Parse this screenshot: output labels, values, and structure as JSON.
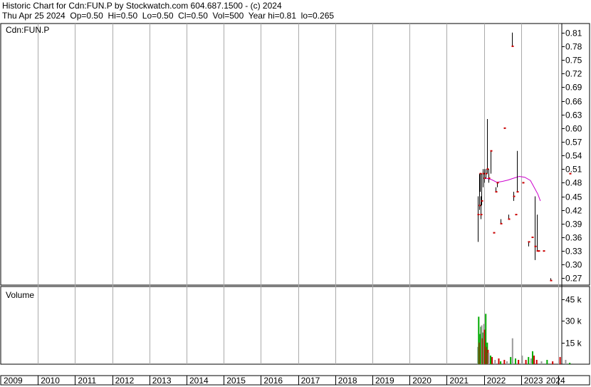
{
  "header": {
    "title": "Historic Chart for Cdn:FUN.P by Stockwatch.com 604.687.1500 - (c) 2024",
    "quote": "Thu Apr 25 2024  Op=0.50  Hi=0.50  Lo=0.50  Cl=0.50  Vol=500  Year hi=0.81  lo=0.265"
  },
  "colors": {
    "frame": "#000000",
    "grid": "#aaaaaa",
    "price_bar": "#000000",
    "close_mark": "#cc0000",
    "moving_average": "#cc00cc",
    "volume_up": "#00aa00",
    "volume_down": "#cc0000",
    "volume_flat": "#999999"
  },
  "chart_data": [
    {
      "type": "line",
      "title": "Cdn:FUN.P",
      "ylim": [
        0.255,
        0.83
      ],
      "y_ticks": [
        "0.81",
        "0.78",
        "0.75",
        "0.72",
        "0.69",
        "0.66",
        "0.63",
        "0.60",
        "0.57",
        "0.54",
        "0.51",
        "0.48",
        "0.45",
        "0.42",
        "0.39",
        "0.36",
        "0.33",
        "0.30",
        "0.27"
      ],
      "grid": true,
      "x_range": [
        2009.0,
        2024.33
      ],
      "series": [
        {
          "kind": "hlc_bars",
          "points": [
            {
              "x": 2021.84,
              "hi": 0.45,
              "lo": 0.35,
              "c": 0.41
            },
            {
              "x": 2021.87,
              "hi": 0.5,
              "lo": 0.42,
              "c": 0.43
            },
            {
              "x": 2021.9,
              "hi": 0.5,
              "lo": 0.46,
              "c": 0.5
            },
            {
              "x": 2021.92,
              "hi": 0.45,
              "lo": 0.4,
              "c": 0.41
            },
            {
              "x": 2021.94,
              "hi": 0.5,
              "lo": 0.43,
              "c": 0.44
            },
            {
              "x": 2021.97,
              "hi": 0.51,
              "lo": 0.47,
              "c": 0.5
            },
            {
              "x": 2022.0,
              "hi": 0.51,
              "lo": 0.48,
              "c": 0.49
            },
            {
              "x": 2022.05,
              "hi": 0.51,
              "lo": 0.49,
              "c": 0.5
            },
            {
              "x": 2022.09,
              "hi": 0.62,
              "lo": 0.5,
              "c": 0.51
            },
            {
              "x": 2022.13,
              "hi": 0.51,
              "lo": 0.48,
              "c": 0.49
            },
            {
              "x": 2022.18,
              "hi": 0.55,
              "lo": 0.5,
              "c": 0.55
            },
            {
              "x": 2022.25,
              "hi": 0.37,
              "lo": 0.37,
              "c": 0.37
            },
            {
              "x": 2022.32,
              "hi": 0.47,
              "lo": 0.46,
              "c": 0.46
            },
            {
              "x": 2022.35,
              "hi": 0.48,
              "lo": 0.47,
              "c": 0.48
            },
            {
              "x": 2022.45,
              "hi": 0.4,
              "lo": 0.39,
              "c": 0.39
            },
            {
              "x": 2022.55,
              "hi": 0.6,
              "lo": 0.6,
              "c": 0.6
            },
            {
              "x": 2022.65,
              "hi": 0.41,
              "lo": 0.4,
              "c": 0.4
            },
            {
              "x": 2022.75,
              "hi": 0.81,
              "lo": 0.78,
              "c": 0.78
            },
            {
              "x": 2022.79,
              "hi": 0.46,
              "lo": 0.44,
              "c": 0.45
            },
            {
              "x": 2022.85,
              "hi": 0.41,
              "lo": 0.41,
              "c": 0.41
            },
            {
              "x": 2022.88,
              "hi": 0.55,
              "lo": 0.46,
              "c": 0.46
            },
            {
              "x": 2023.05,
              "hi": 0.48,
              "lo": 0.48,
              "c": 0.48
            },
            {
              "x": 2023.2,
              "hi": 0.35,
              "lo": 0.34,
              "c": 0.35
            },
            {
              "x": 2023.3,
              "hi": 0.36,
              "lo": 0.36,
              "c": 0.36
            },
            {
              "x": 2023.36,
              "hi": 0.45,
              "lo": 0.31,
              "c": 0.34
            },
            {
              "x": 2023.42,
              "hi": 0.41,
              "lo": 0.33,
              "c": 0.33
            },
            {
              "x": 2023.47,
              "hi": 0.33,
              "lo": 0.33,
              "c": 0.33
            },
            {
              "x": 2023.6,
              "hi": 0.33,
              "lo": 0.33,
              "c": 0.33
            },
            {
              "x": 2023.78,
              "hi": 0.27,
              "lo": 0.265,
              "c": 0.265
            },
            {
              "x": 2024.31,
              "hi": 0.5,
              "lo": 0.5,
              "c": 0.5
            }
          ]
        },
        {
          "kind": "moving_average",
          "points": [
            [
              2022.05,
              0.49
            ],
            [
              2022.2,
              0.487
            ],
            [
              2022.35,
              0.481
            ],
            [
              2022.5,
              0.483
            ],
            [
              2022.65,
              0.486
            ],
            [
              2022.8,
              0.49
            ],
            [
              2022.95,
              0.494
            ],
            [
              2023.1,
              0.492
            ],
            [
              2023.25,
              0.485
            ],
            [
              2023.35,
              0.47
            ],
            [
              2023.45,
              0.455
            ],
            [
              2023.52,
              0.44
            ]
          ]
        }
      ]
    },
    {
      "type": "bar",
      "title": "Volume",
      "ylim": [
        0,
        54000
      ],
      "y_ticks": [
        "45 k",
        "30 k",
        "15 k"
      ],
      "y_tick_values": [
        45000,
        30000,
        15000
      ],
      "x_tick_labels": [
        "2009",
        "2010",
        "2011",
        "2012",
        "2013",
        "2014",
        "2015",
        "2016",
        "2017",
        "2018",
        "2019",
        "2020",
        "2021",
        "2022",
        "2023",
        "2024"
      ],
      "bars": [
        {
          "x": 2021.84,
          "v": 12000,
          "c": "volume_flat"
        },
        {
          "x": 2021.86,
          "v": 33000,
          "c": "volume_up"
        },
        {
          "x": 2021.88,
          "v": 15000,
          "c": "volume_down"
        },
        {
          "x": 2021.9,
          "v": 21000,
          "c": "volume_up"
        },
        {
          "x": 2021.92,
          "v": 26000,
          "c": "volume_up"
        },
        {
          "x": 2021.94,
          "v": 27000,
          "c": "volume_flat"
        },
        {
          "x": 2021.96,
          "v": 18000,
          "c": "volume_down"
        },
        {
          "x": 2021.98,
          "v": 22000,
          "c": "volume_up"
        },
        {
          "x": 2022.0,
          "v": 28000,
          "c": "volume_flat"
        },
        {
          "x": 2022.02,
          "v": 24000,
          "c": "volume_down"
        },
        {
          "x": 2022.05,
          "v": 35000,
          "c": "volume_up"
        },
        {
          "x": 2022.07,
          "v": 12000,
          "c": "volume_down"
        },
        {
          "x": 2022.09,
          "v": 15000,
          "c": "volume_up"
        },
        {
          "x": 2022.11,
          "v": 10000,
          "c": "volume_down"
        },
        {
          "x": 2022.13,
          "v": 8000,
          "c": "volume_flat"
        },
        {
          "x": 2022.18,
          "v": 6000,
          "c": "volume_up"
        },
        {
          "x": 2022.22,
          "v": 5000,
          "c": "volume_down"
        },
        {
          "x": 2022.3,
          "v": 3000,
          "c": "volume_flat"
        },
        {
          "x": 2022.4,
          "v": 4000,
          "c": "volume_down"
        },
        {
          "x": 2022.45,
          "v": 2000,
          "c": "volume_up"
        },
        {
          "x": 2022.55,
          "v": 3000,
          "c": "volume_down"
        },
        {
          "x": 2022.62,
          "v": 2000,
          "c": "volume_flat"
        },
        {
          "x": 2022.72,
          "v": 5000,
          "c": "volume_up"
        },
        {
          "x": 2022.77,
          "v": 18000,
          "c": "volume_flat"
        },
        {
          "x": 2022.85,
          "v": 4000,
          "c": "volume_up"
        },
        {
          "x": 2022.93,
          "v": 3000,
          "c": "volume_down"
        },
        {
          "x": 2023.03,
          "v": 6000,
          "c": "volume_flat"
        },
        {
          "x": 2023.13,
          "v": 3000,
          "c": "volume_down"
        },
        {
          "x": 2023.2,
          "v": 5000,
          "c": "volume_up"
        },
        {
          "x": 2023.27,
          "v": 4000,
          "c": "volume_flat"
        },
        {
          "x": 2023.31,
          "v": 9000,
          "c": "volume_up"
        },
        {
          "x": 2023.35,
          "v": 6000,
          "c": "volume_down"
        },
        {
          "x": 2023.42,
          "v": 3000,
          "c": "volume_down"
        },
        {
          "x": 2023.55,
          "v": 2000,
          "c": "volume_flat"
        },
        {
          "x": 2023.7,
          "v": 3000,
          "c": "volume_up"
        },
        {
          "x": 2023.85,
          "v": 2000,
          "c": "volume_down"
        },
        {
          "x": 2024.05,
          "v": 5000,
          "c": "volume_down"
        },
        {
          "x": 2024.2,
          "v": 3000,
          "c": "volume_flat"
        },
        {
          "x": 2024.31,
          "v": 1000,
          "c": "volume_up"
        }
      ]
    }
  ]
}
